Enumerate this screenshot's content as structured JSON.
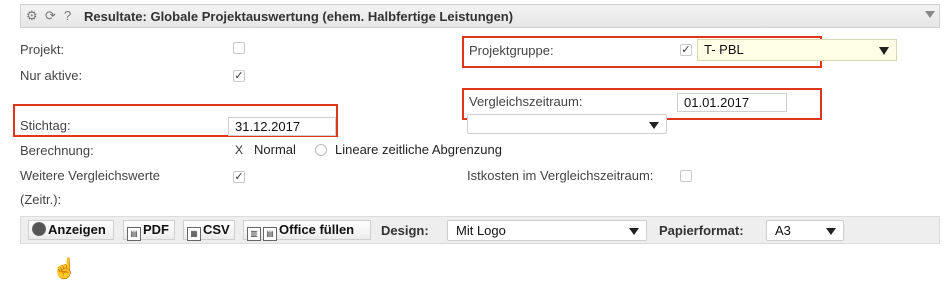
{
  "header": {
    "title": "Resultate: Globale Projektauswertung (ehem. Halbfertige Leistungen)",
    "icons": [
      "gear-icon",
      "refresh-icon",
      "help-icon",
      "collapse-arrow-icon"
    ]
  },
  "form": {
    "projekt_label": "Projekt:",
    "nur_aktive_label": "Nur aktive:",
    "nur_aktive_checked": true,
    "projektgruppe_label": "Projektgruppe:",
    "projektgruppe_checked": true,
    "projektgruppe_value": "T- PBL",
    "vergleichszeitraum_label": "Vergleichszeitraum:",
    "vergleichszeitraum_value": "01.01.2017",
    "stichtag_label": "Stichtag:",
    "stichtag_value": "31.12.2017",
    "berechnung_label": "Berechnung:",
    "berechnung_options": [
      "Normal",
      "Lineare zeitliche Abgrenzung"
    ],
    "berechnung_selected": "Normal",
    "weitere_label_line1": "Weitere Vergleichswerte",
    "weitere_label_line2": "(Zeitr.):",
    "weitere_checked": true,
    "istkosten_label": "Istkosten im Vergleichszeitraum:",
    "istkosten_checked": false,
    "checkmark": "✓",
    "cross": "X"
  },
  "toolbar": {
    "anzeigen": "Anzeigen",
    "pdf": "PDF",
    "csv": "CSV",
    "office": "Office füllen",
    "design_label": "Design:",
    "design_value": "Mit Logo",
    "papier_label": "Papierformat:",
    "papier_value": "A3"
  },
  "colors": {
    "highlight": "#e0361b",
    "projektgruppe_bg": "#ffffe6",
    "dropdown_arrow_yellow": "#e8e800"
  }
}
